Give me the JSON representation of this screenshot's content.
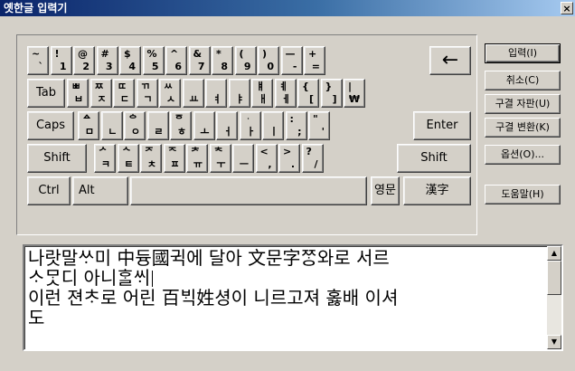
{
  "window": {
    "title": "옛한글 입력기",
    "close_label": "×"
  },
  "keyboard": {
    "row1": [
      {
        "name": "key-tilde",
        "up": "~",
        "lo": "`"
      },
      {
        "name": "key-1",
        "up": "!",
        "lo": "1"
      },
      {
        "name": "key-2",
        "up": "@",
        "lo": "2"
      },
      {
        "name": "key-3",
        "up": "#",
        "lo": "3"
      },
      {
        "name": "key-4",
        "up": "$",
        "lo": "4"
      },
      {
        "name": "key-5",
        "up": "%",
        "lo": "5"
      },
      {
        "name": "key-6",
        "up": "^",
        "lo": "6"
      },
      {
        "name": "key-7",
        "up": "&",
        "lo": "7"
      },
      {
        "name": "key-8",
        "up": "*",
        "lo": "8"
      },
      {
        "name": "key-9",
        "up": "(",
        "lo": "9"
      },
      {
        "name": "key-0",
        "up": ")",
        "lo": "0"
      },
      {
        "name": "key-minus",
        "up": "—",
        "lo": "-"
      },
      {
        "name": "key-plus",
        "up": "+",
        "lo": "="
      }
    ],
    "backspace": "←",
    "tab": "Tab",
    "row2": [
      {
        "name": "key-q",
        "up": "ㅃ",
        "lo": "ㅂ"
      },
      {
        "name": "key-w",
        "up": "ㅉ",
        "lo": "ㅈ"
      },
      {
        "name": "key-e",
        "up": "ㄸ",
        "lo": "ㄷ"
      },
      {
        "name": "key-r",
        "up": "ㄲ",
        "lo": "ㄱ"
      },
      {
        "name": "key-t",
        "up": "ㅆ",
        "lo": "ㅅ"
      },
      {
        "name": "key-y",
        "up": "",
        "lo": "ㅛ"
      },
      {
        "name": "key-u",
        "up": "",
        "lo": "ㅕ"
      },
      {
        "name": "key-i",
        "up": "",
        "lo": "ㅑ"
      },
      {
        "name": "key-o",
        "up": "ㅒ",
        "lo": "ㅐ"
      },
      {
        "name": "key-p",
        "up": "ㅖ",
        "lo": "ㅔ"
      },
      {
        "name": "key-lbracket",
        "up": "{",
        "lo": "["
      },
      {
        "name": "key-rbracket",
        "up": "}",
        "lo": "]"
      },
      {
        "name": "key-backslash",
        "up": "|",
        "lo": "₩"
      }
    ],
    "caps": "Caps",
    "row3": [
      {
        "name": "key-a",
        "up": "ᅀ",
        "lo": "ㅁ"
      },
      {
        "name": "key-s",
        "up": "",
        "lo": "ㄴ"
      },
      {
        "name": "key-d",
        "up": "ᅌ",
        "lo": "ㅇ"
      },
      {
        "name": "key-f",
        "up": "",
        "lo": "ㄹ"
      },
      {
        "name": "key-g",
        "up": "ᅙ",
        "lo": "ㅎ"
      },
      {
        "name": "key-h",
        "up": "",
        "lo": "ㅗ"
      },
      {
        "name": "key-j",
        "up": "",
        "lo": "ㅓ"
      },
      {
        "name": "key-k",
        "up": "ᆞ",
        "lo": "ㅏ"
      },
      {
        "name": "key-l",
        "up": "",
        "lo": "ㅣ"
      },
      {
        "name": "key-semicolon",
        "up": ":",
        "lo": ";"
      },
      {
        "name": "key-quote",
        "up": "\"",
        "lo": "'"
      }
    ],
    "enter": "Enter",
    "shift": "Shift",
    "row4": [
      {
        "name": "key-z",
        "up": "ᄼ",
        "lo": "ㅋ"
      },
      {
        "name": "key-x",
        "up": "ᄾ",
        "lo": "ㅌ"
      },
      {
        "name": "key-c",
        "up": "ᅎ",
        "lo": "ㅊ"
      },
      {
        "name": "key-v",
        "up": "ᅐ",
        "lo": "ㅍ"
      },
      {
        "name": "key-b",
        "up": "ᅔ",
        "lo": "ㅠ"
      },
      {
        "name": "key-n",
        "up": "ᅕ",
        "lo": "ㅜ"
      },
      {
        "name": "key-m",
        "up": "",
        "lo": "ㅡ"
      },
      {
        "name": "key-comma",
        "up": "<",
        "lo": ","
      },
      {
        "name": "key-period",
        "up": ">",
        "lo": "."
      },
      {
        "name": "key-slash",
        "up": "?",
        "lo": "/"
      }
    ],
    "ctrl": "Ctrl",
    "alt": "Alt",
    "hangul": "영문",
    "hanja": "漢字"
  },
  "buttons": [
    {
      "name": "input-button",
      "label": "입력(I)"
    },
    {
      "name": "cancel-button",
      "label": "취소(C)"
    },
    {
      "name": "jamo-split-button",
      "label": "구결 자판(U)"
    },
    {
      "name": "jamo-convert-button",
      "label": "구결 변환(K)"
    },
    {
      "name": "options-button",
      "label": "옵션(O)..."
    },
    {
      "name": "help-button",
      "label": "도움말(H)"
    }
  ],
  "editor": {
    "line1": "나랏말ᄊᆞ미 中듕國귁에 달아 文문字ᄍᆞᆼ와로 서르",
    "line2": "ᄉᆞᄆᆞᆺ디 아니ᄒᆞᆯᄊᆡ",
    "line3": "이런 젼ᄎᆞ로 어린 百ᄇᆡᆨ姓셩이 니르고져 홇배 이셔",
    "line4": "도"
  }
}
